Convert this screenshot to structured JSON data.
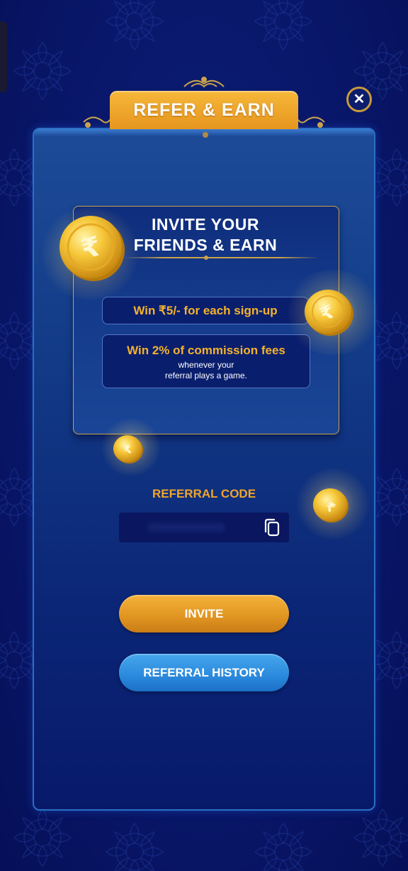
{
  "header": {
    "title": "REFER & EARN"
  },
  "card": {
    "title_line1": "INVITE YOUR",
    "title_line2": "FRIENDS & EARN",
    "signup_text": "Win ₹5/- for each sign-up",
    "commission_title": "Win 2% of commission fees",
    "commission_line2": "whenever your",
    "commission_line3": "referral plays a game."
  },
  "referral": {
    "label": "REFERRAL CODE",
    "code": ""
  },
  "buttons": {
    "invite": "INVITE",
    "history": "REFERRAL HISTORY"
  },
  "icons": {
    "close": "close-icon",
    "copy": "copy-icon",
    "coin": "rupee-coin-icon"
  },
  "colors": {
    "gold": "#f5b32c",
    "tab_orange": "#e6961e",
    "panel_blue": "#123a86",
    "button_blue": "#2a89dc"
  }
}
